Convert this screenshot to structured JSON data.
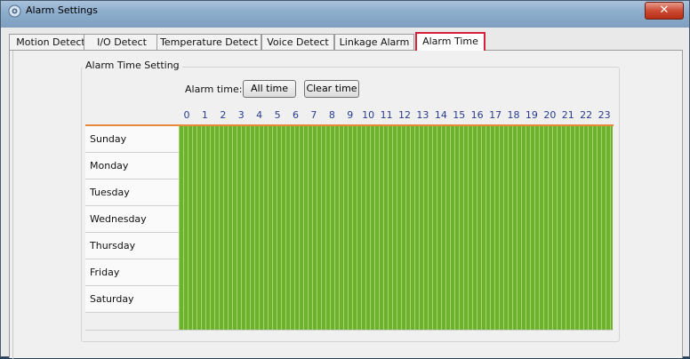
{
  "window": {
    "title": "Alarm Settings",
    "close_glyph": "✕"
  },
  "tabs": [
    {
      "label": "Motion Detect",
      "active": false
    },
    {
      "label": "I/O Detect",
      "active": false
    },
    {
      "label": "Temperature Detect",
      "active": false
    },
    {
      "label": "Voice Detect",
      "active": false
    },
    {
      "label": "Linkage Alarm",
      "active": false
    },
    {
      "label": "Alarm Time",
      "active": true
    }
  ],
  "group": {
    "title": "Alarm Time Setting"
  },
  "alarm_time": {
    "label": "Alarm time:",
    "all_time_button": "All time",
    "clear_time_button": "Clear time"
  },
  "schedule": {
    "hours": [
      "0",
      "1",
      "2",
      "3",
      "4",
      "5",
      "6",
      "7",
      "8",
      "9",
      "10",
      "11",
      "12",
      "13",
      "14",
      "15",
      "16",
      "17",
      "18",
      "19",
      "20",
      "21",
      "22",
      "23"
    ],
    "days": [
      "Sunday",
      "Monday",
      "Tuesday",
      "Wednesday",
      "Thursday",
      "Friday",
      "Saturday"
    ],
    "all_selected": true
  },
  "colors": {
    "selected_cell": "#6db12f",
    "active_tab_border": "#d6203b",
    "hour_label": "#2a3c8c",
    "header_rule": "#e8893c"
  }
}
